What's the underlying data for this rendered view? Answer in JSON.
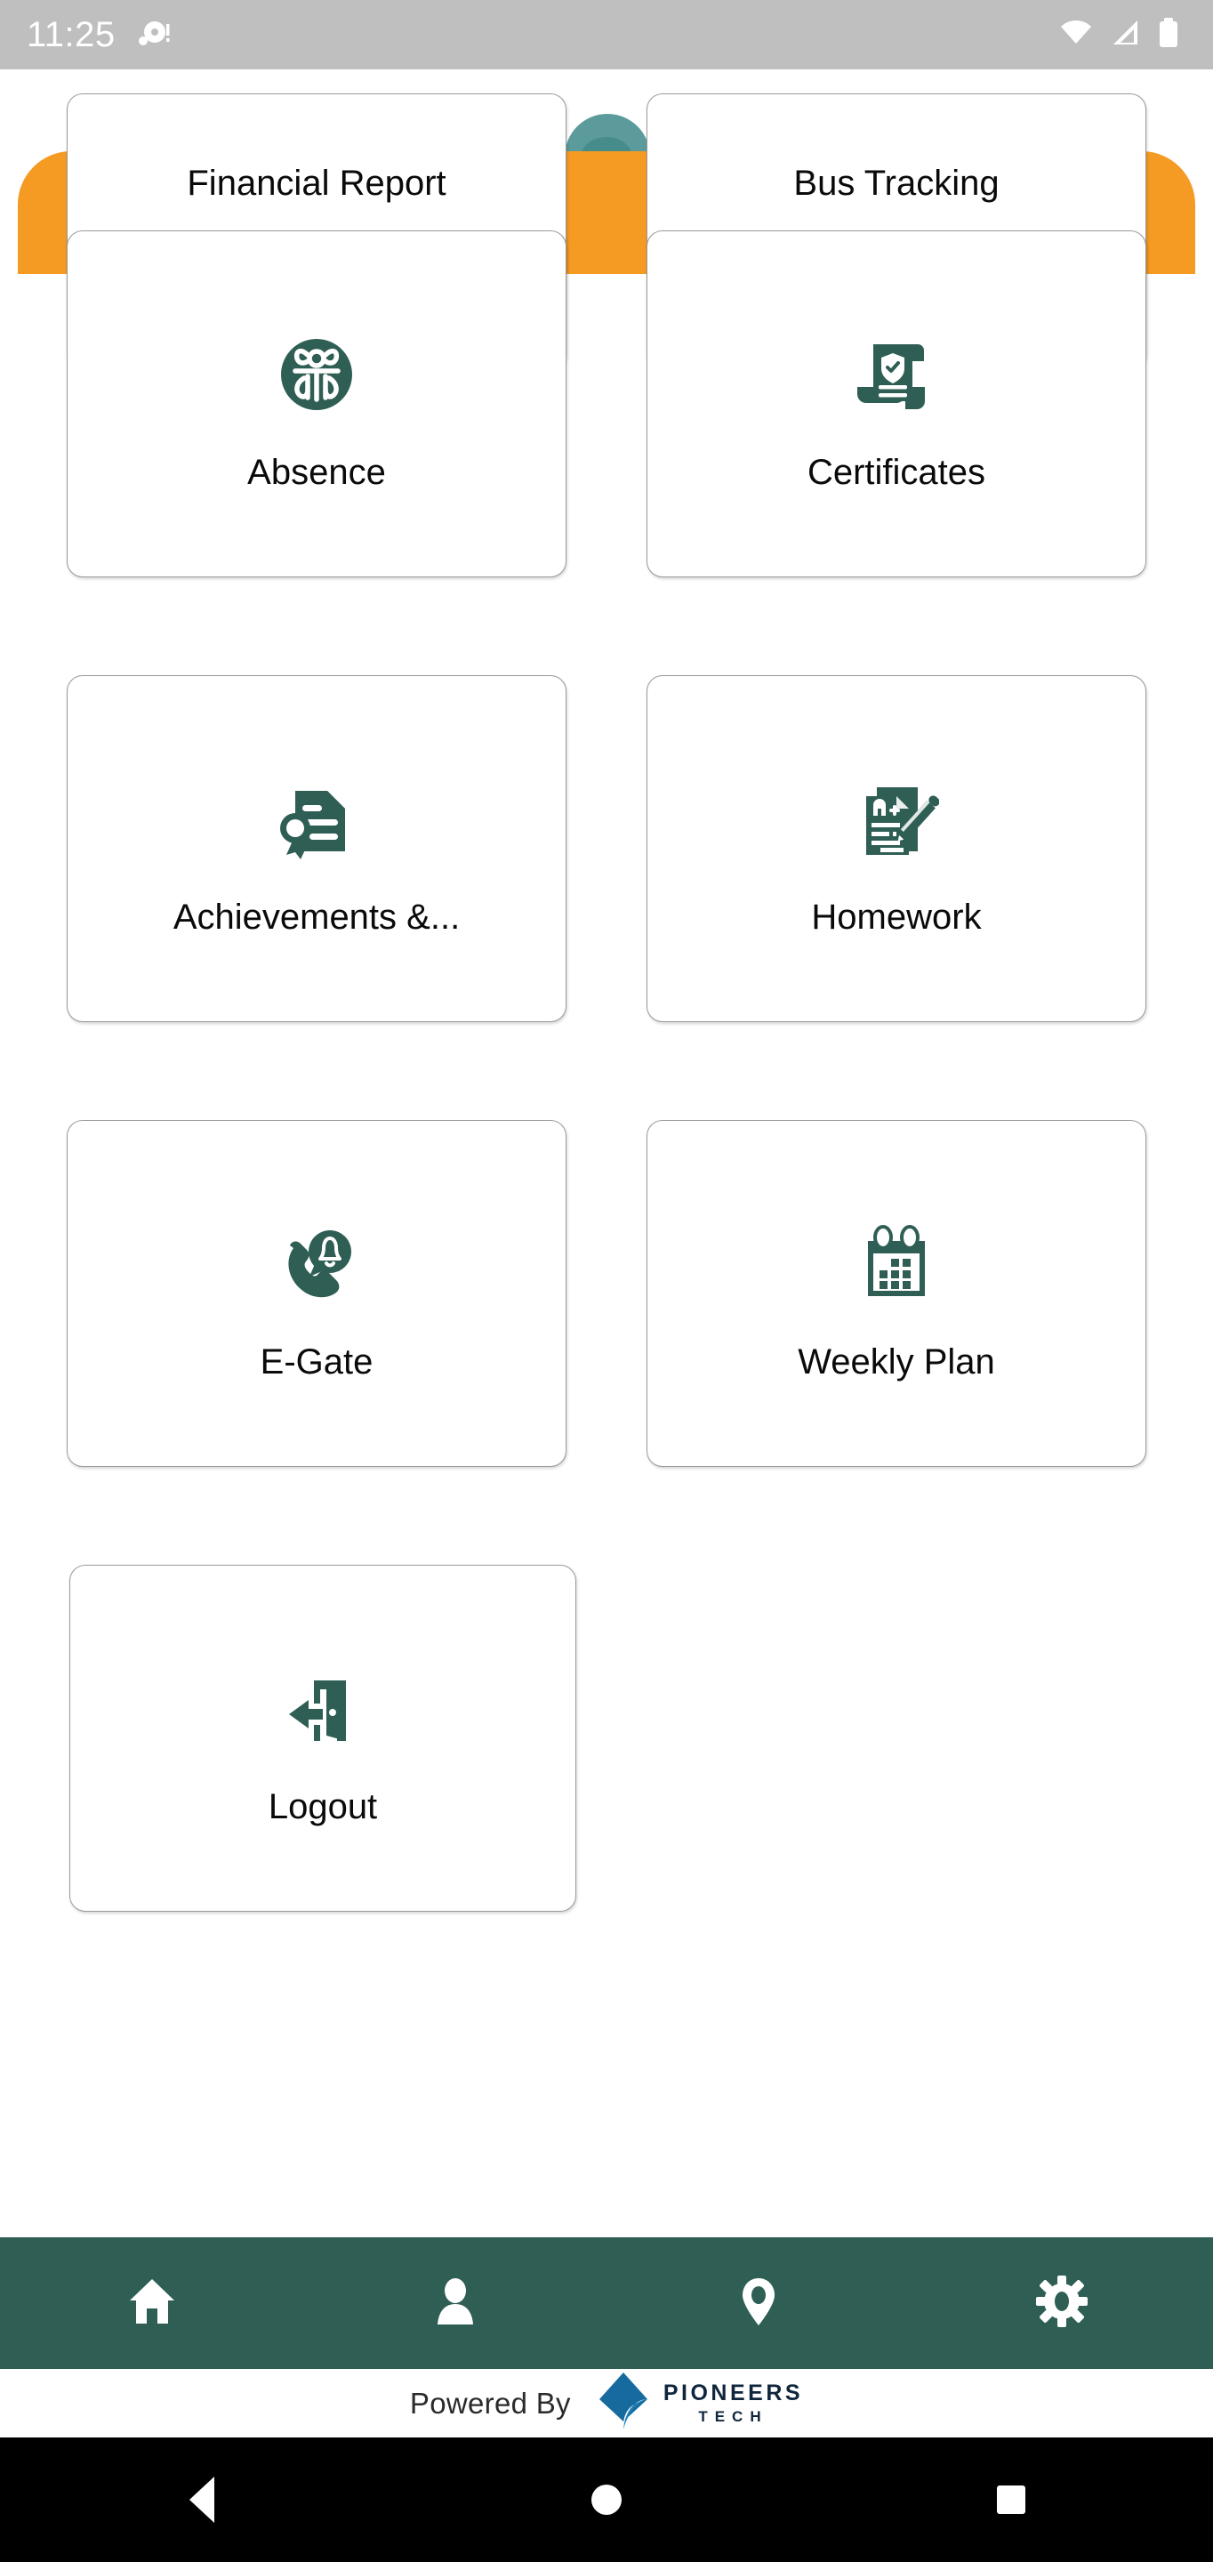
{
  "status_bar": {
    "time": "11:25",
    "icons": [
      "camera-notification-icon",
      "wifi-icon",
      "cellular-signal-icon",
      "battery-icon"
    ]
  },
  "theme": {
    "header_orange": "#f59a23",
    "brand_green": "#2f5e55",
    "icon_green": "#2f5e55",
    "logo_blue": "#166a9e",
    "card_border": "#9a9a9a",
    "status_bar_bg": "#bfbfbf",
    "system_nav_bg": "#000000"
  },
  "grid": {
    "rows": [
      {
        "partial": true,
        "tiles": [
          {
            "label": "Financial Report",
            "icon": "financial-report-icon"
          },
          {
            "label": "Bus Tracking",
            "icon": "bus-tracking-icon"
          }
        ]
      },
      {
        "partial": false,
        "tiles": [
          {
            "label": "Absence",
            "icon": "absence-person-badge-icon"
          },
          {
            "label": "Certificates",
            "icon": "certificate-scroll-shield-icon"
          }
        ]
      },
      {
        "partial": false,
        "tiles": [
          {
            "label": "Achievements &...",
            "icon": "achievements-award-document-icon"
          },
          {
            "label": "Homework",
            "icon": "homework-paper-pencil-icon"
          }
        ]
      },
      {
        "partial": false,
        "tiles": [
          {
            "label": "E-Gate",
            "icon": "egate-phone-bell-icon"
          },
          {
            "label": "Weekly Plan",
            "icon": "weekly-plan-calendar-icon"
          }
        ]
      },
      {
        "partial": false,
        "single": true,
        "tiles": [
          {
            "label": "Logout",
            "icon": "logout-door-arrow-icon"
          }
        ]
      }
    ]
  },
  "bottom_nav": {
    "items": [
      {
        "name": "home",
        "icon": "home-icon"
      },
      {
        "name": "profile",
        "icon": "person-icon"
      },
      {
        "name": "location",
        "icon": "map-pin-icon"
      },
      {
        "name": "settings",
        "icon": "gear-icon"
      }
    ]
  },
  "footer": {
    "powered_by": "Powered By",
    "brand_name": "PIONEERS",
    "brand_sub": "TECH",
    "brand_logo": "pioneers-diamond-logo"
  },
  "system_nav": {
    "back": "back-button",
    "home": "home-button",
    "recents": "recents-button"
  }
}
